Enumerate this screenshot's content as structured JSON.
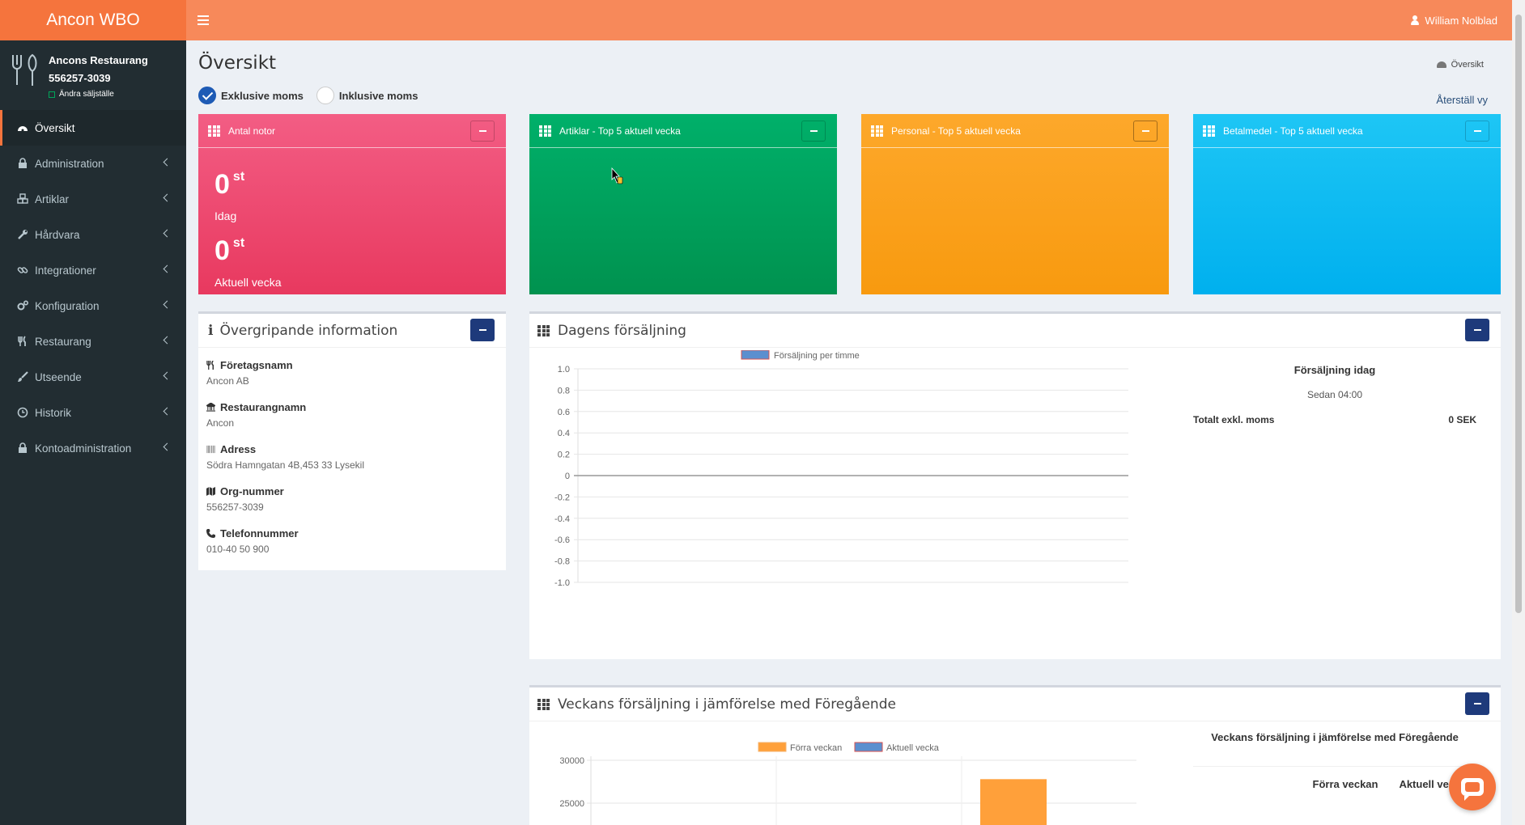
{
  "header": {
    "logo": "Ancon WBO",
    "user": "William Nolblad"
  },
  "sidebar": {
    "profile_name": "Ancons Restaurang",
    "profile_number": "556257-3039",
    "change_location": "Ändra säljställe",
    "items": [
      {
        "label": "Översikt",
        "icon": "dashboard-icon"
      },
      {
        "label": "Administration",
        "icon": "lock-icon"
      },
      {
        "label": "Artiklar",
        "icon": "cubes-icon"
      },
      {
        "label": "Hårdvara",
        "icon": "wrench-icon"
      },
      {
        "label": "Integrationer",
        "icon": "link-icon"
      },
      {
        "label": "Konfiguration",
        "icon": "cogs-icon"
      },
      {
        "label": "Restaurang",
        "icon": "cutlery-icon"
      },
      {
        "label": "Utseende",
        "icon": "brush-icon"
      },
      {
        "label": "Historik",
        "icon": "clock-icon"
      },
      {
        "label": "Kontoadministration",
        "icon": "lock-icon"
      }
    ]
  },
  "page": {
    "title": "Översikt",
    "breadcrumb": "Översikt",
    "reset_view": "Återställ vy",
    "vat_exclusive": "Exklusive moms",
    "vat_inclusive": "Inklusive moms"
  },
  "widgets": {
    "notes": {
      "title": "Antal notor",
      "today_value": "0",
      "today_unit": "st",
      "today_label": "Idag",
      "week_value": "0",
      "week_unit": "st",
      "week_label": "Aktuell vecka",
      "color": "#e8395f"
    },
    "articles": {
      "title": "Artiklar - Top 5 aktuell vecka",
      "color": "#00a65a"
    },
    "staff": {
      "title": "Personal - Top 5 aktuell vecka",
      "color": "#f89a0f"
    },
    "payment": {
      "title": "Betalmedel - Top 5 aktuell vecka",
      "color": "#00b0ee"
    }
  },
  "info": {
    "title": "Övergripande information",
    "rows": [
      {
        "label": "Företagsnamn",
        "value": "Ancon AB",
        "icon": "cutlery-icon"
      },
      {
        "label": "Restaurangnamn",
        "value": "Ancon",
        "icon": "bank-icon"
      },
      {
        "label": "Adress",
        "value": "Södra Hamngatan 4B,453 33 Lysekil",
        "icon": "barcode-icon"
      },
      {
        "label": "Org-nummer",
        "value": "556257-3039",
        "icon": "map-icon"
      },
      {
        "label": "Telefonnummer",
        "value": "010-40 50 900",
        "icon": "phone-icon"
      }
    ]
  },
  "daily_sales": {
    "title": "Dagens försäljning",
    "side_title": "Försäljning idag",
    "side_since": "Sedan 04:00",
    "total_label": "Totalt exkl. moms",
    "total_value": "0 SEK"
  },
  "weekly_sales": {
    "title": "Veckans försäljning i jämförelse med Föregående",
    "side_title": "Veckans försäljning i jämförelse med Föregående",
    "col_prev": "Förra veckan",
    "col_current": "Aktuell vecka"
  },
  "chart_data": [
    {
      "type": "line",
      "legend": [
        "Försäljning per timme"
      ],
      "series": [
        {
          "name": "Försäljning per timme",
          "values": [],
          "color": "#5b8fcf"
        }
      ],
      "yticks": [
        "1.0",
        "0.8",
        "0.6",
        "0.4",
        "0.2",
        "0",
        "-0.2",
        "-0.4",
        "-0.6",
        "-0.8",
        "-1.0"
      ],
      "ylim": [
        -1.0,
        1.0
      ],
      "legend_position": "top",
      "grid": true
    },
    {
      "type": "bar",
      "legend": [
        "Förra veckan",
        "Aktuell vecka"
      ],
      "series": [
        {
          "name": "Förra veckan",
          "color": "#ffa03a"
        },
        {
          "name": "Aktuell vecka",
          "color": "#5b8fcf"
        }
      ],
      "yticks": [
        "30000",
        "25000"
      ],
      "visible_bar_value": 27800,
      "legend_position": "top",
      "grid": true
    }
  ]
}
